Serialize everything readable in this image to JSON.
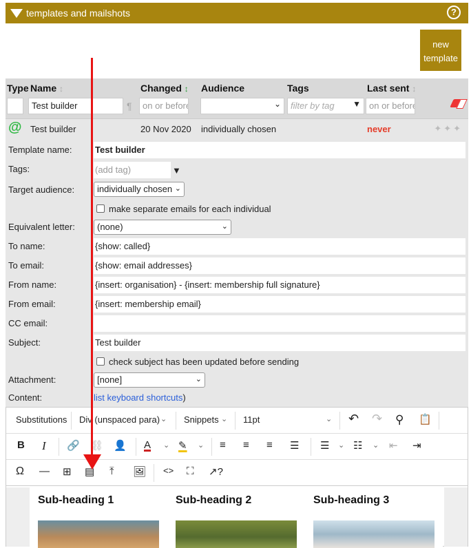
{
  "header": {
    "title": "templates and mailshots",
    "help_icon": "?"
  },
  "new_template_button": {
    "line1": "new",
    "line2": "template"
  },
  "table": {
    "columns": {
      "type": "Type",
      "name": "Name",
      "changed": "Changed",
      "audience": "Audience",
      "tags": "Tags",
      "last_sent": "Last sent"
    },
    "sort_icons": {
      "name": "↕",
      "changed": "↕",
      "last_sent": "↕"
    },
    "filters": {
      "name": "Test builder",
      "para_icon": "¶",
      "changed_placeholder": "on or before.",
      "audience": "",
      "tags_placeholder": "filter by tag",
      "last_sent_placeholder": "on or before."
    },
    "row": {
      "type_icon": "@",
      "name": "Test builder",
      "changed": "20 Nov 2020",
      "audience": "individually chosen",
      "last_sent": "never"
    }
  },
  "form": {
    "template_name_label": "Template name:",
    "template_name": "Test builder",
    "tags_label": "Tags:",
    "tags_placeholder": "(add tag)",
    "target_audience_label": "Target audience:",
    "target_audience": "individually chosen",
    "separate_emails_label": "make separate emails for each individual",
    "equivalent_letter_label": "Equivalent letter:",
    "equivalent_letter": "(none)",
    "to_name_label": "To name:",
    "to_name": "{show: called}",
    "to_email_label": "To email:",
    "to_email": "{show: email addresses}",
    "from_name_label": "From name:",
    "from_name": "{insert: organisation} - {insert: membership full signature}",
    "from_email_label": "From email:",
    "from_email": "{insert: membership email}",
    "cc_email_label": "CC email:",
    "cc_email": "",
    "subject_label": "Subject:",
    "subject": "Test builder",
    "check_subject_label": "check subject has been updated before sending",
    "attachment_label": "Attachment:",
    "attachment": "[none]",
    "content_label": "Content:",
    "shortcuts_link": "list keyboard shortcuts",
    "shortcuts_close": ")"
  },
  "editor": {
    "row1": {
      "substitutions": "Substitutions",
      "block_format": "Div (unspaced para)",
      "snippets": "Snippets",
      "font_size": "11pt"
    },
    "headings": [
      "Sub-heading 1",
      "Sub-heading 2",
      "Sub-heading 3"
    ]
  },
  "colors": {
    "brand": "#a8850f",
    "accent_red": "#e53d2a",
    "green": "#2fb843",
    "link": "#2b5fd9"
  }
}
